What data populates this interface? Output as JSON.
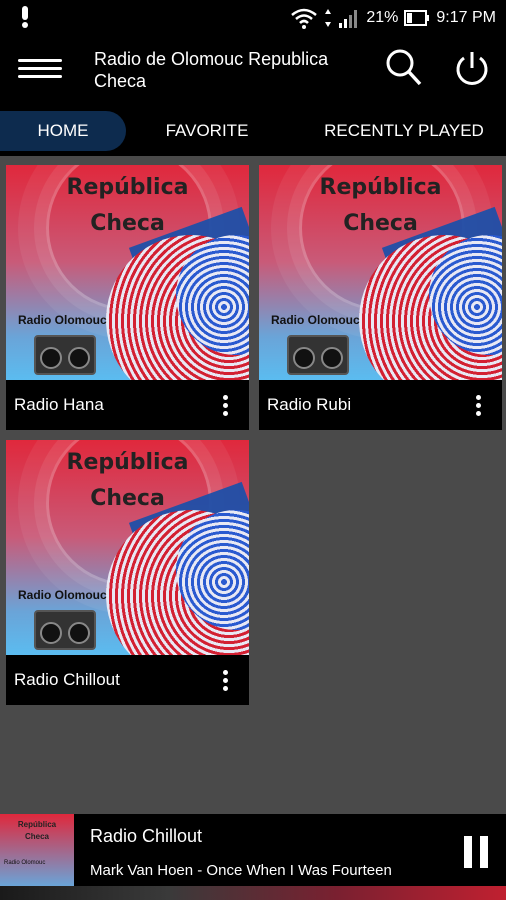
{
  "status_bar": {
    "battery": "21%",
    "time": "9:17 PM"
  },
  "app_bar": {
    "title": "Radio de Olomouc Republica Checa"
  },
  "tabs": [
    {
      "label": "HOME",
      "active": true
    },
    {
      "label": "FAVORITE",
      "active": false
    },
    {
      "label": "RECENTLY PLAYED",
      "active": false
    }
  ],
  "artwork": {
    "line1": "República",
    "line2": "Checa",
    "station": "Radio Olomouc"
  },
  "stations": [
    {
      "name": "Radio Hana"
    },
    {
      "name": "Radio Rubi"
    },
    {
      "name": "Radio Chillout"
    }
  ],
  "player": {
    "station": "Radio Chillout",
    "track": "Mark Van Hoen - Once When I Was Fourteen"
  },
  "colors": {
    "active_tab": "#0d2b4e",
    "background": "#4a4a4a",
    "bar": "#000000"
  }
}
